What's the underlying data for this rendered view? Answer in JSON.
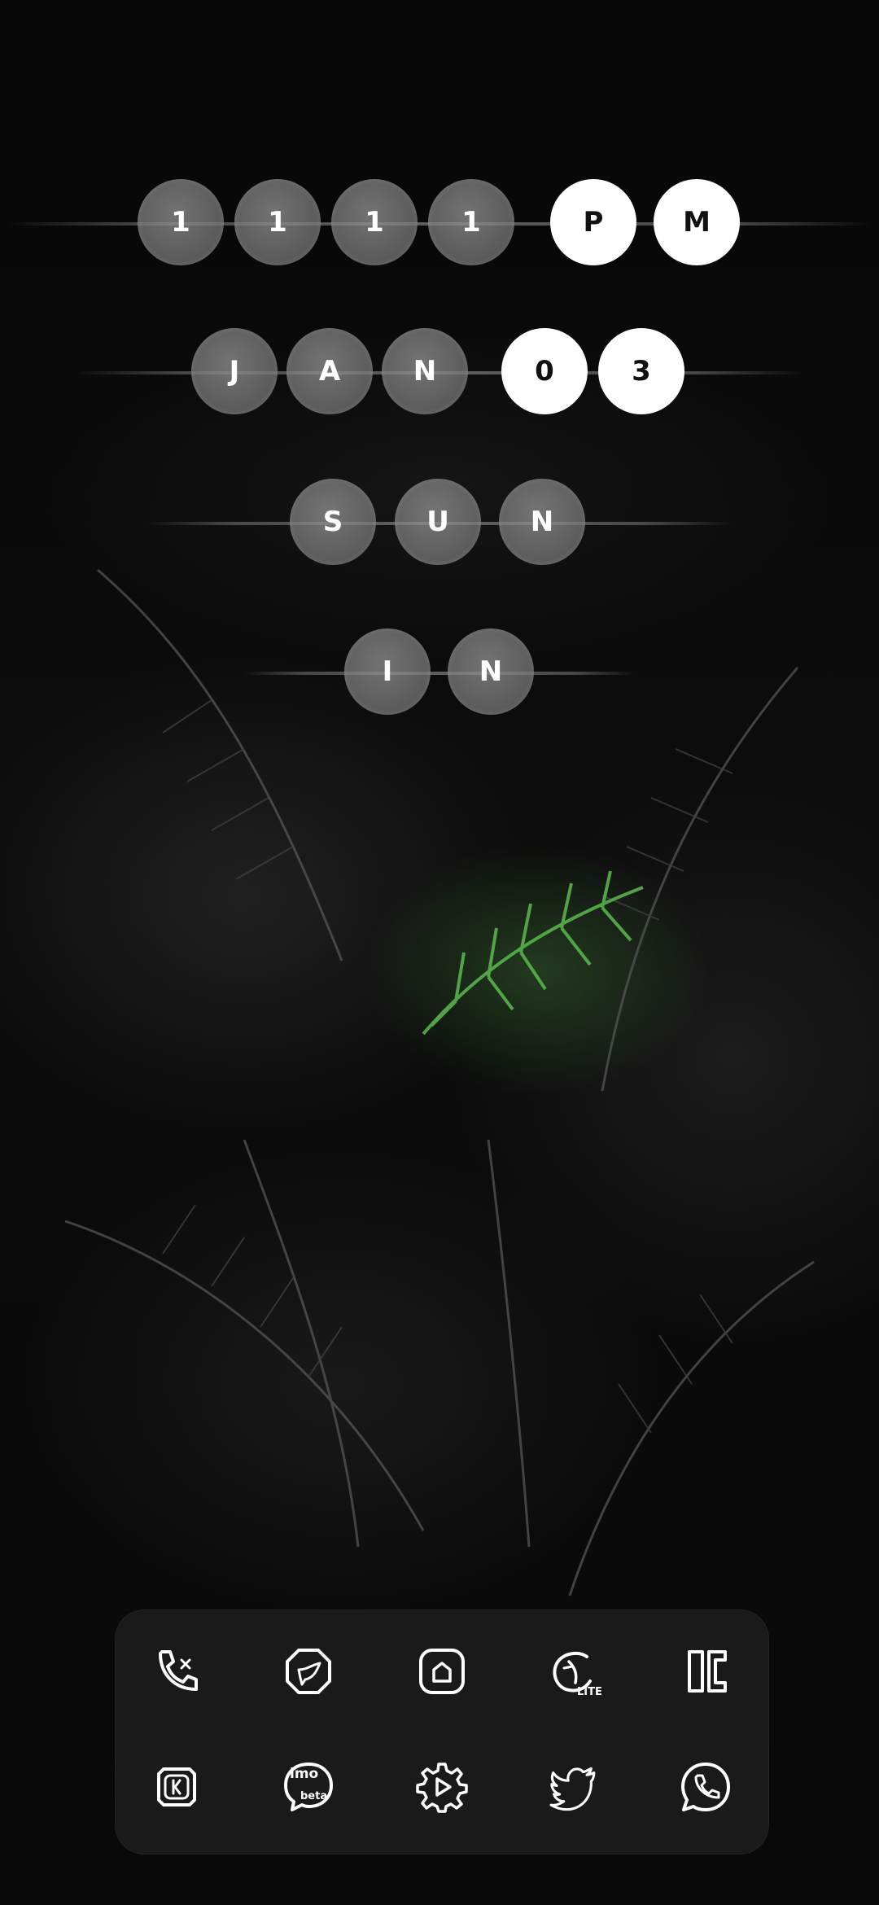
{
  "clock": {
    "time_beads": [
      "1",
      "1",
      "1",
      "1",
      "P",
      "M"
    ],
    "date_beads": [
      "J",
      "A",
      "N",
      "0",
      "3"
    ],
    "day_beads": [
      "S",
      "U",
      "N"
    ],
    "location_beads": [
      "I",
      "N"
    ]
  },
  "dock": {
    "apps": [
      {
        "icon": "phone-dialer-icon"
      },
      {
        "icon": "bird-messenger-icon"
      },
      {
        "icon": "home-app-icon"
      },
      {
        "icon": "lite-app-icon",
        "badge": "LITE"
      },
      {
        "icon": "kc-app-icon"
      },
      {
        "icon": "kinemaster-icon"
      },
      {
        "icon": "imo-beta-icon",
        "line1": "imo",
        "line2": "beta"
      },
      {
        "icon": "settings-gear-icon"
      },
      {
        "icon": "twitter-bird-icon"
      },
      {
        "icon": "whatsapp-icon"
      }
    ]
  },
  "colors": {
    "bead_lit": "#ffffff",
    "bead_dim": "#7a7a7a",
    "icon_stroke": "#ffffff",
    "fern_accent": "#3f9a35"
  }
}
